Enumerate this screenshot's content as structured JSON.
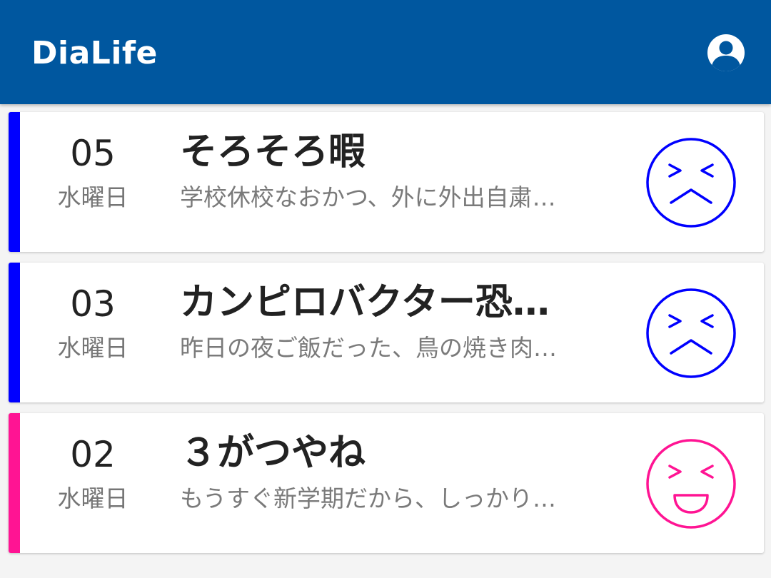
{
  "app_bar": {
    "title": "DiaLife",
    "account_icon": "account-circle-icon",
    "background_color": "#00579f"
  },
  "entries": [
    {
      "day": "05",
      "weekday": "水曜日",
      "title": "そろそろ暇",
      "excerpt": "学校休校なおかつ、外に外出自粛…",
      "mood_icon": "sad-face-icon",
      "color": "#0000ff"
    },
    {
      "day": "03",
      "weekday": "水曜日",
      "title": "カンピロバクター恐…",
      "excerpt": "昨日の夜ご飯だった、鳥の焼き肉…",
      "mood_icon": "sad-face-icon",
      "color": "#0000ff"
    },
    {
      "day": "02",
      "weekday": "水曜日",
      "title": "３がつやね",
      "excerpt": "もうすぐ新学期だから、しっかり…",
      "mood_icon": "happy-face-icon",
      "color": "#ff1493"
    }
  ]
}
